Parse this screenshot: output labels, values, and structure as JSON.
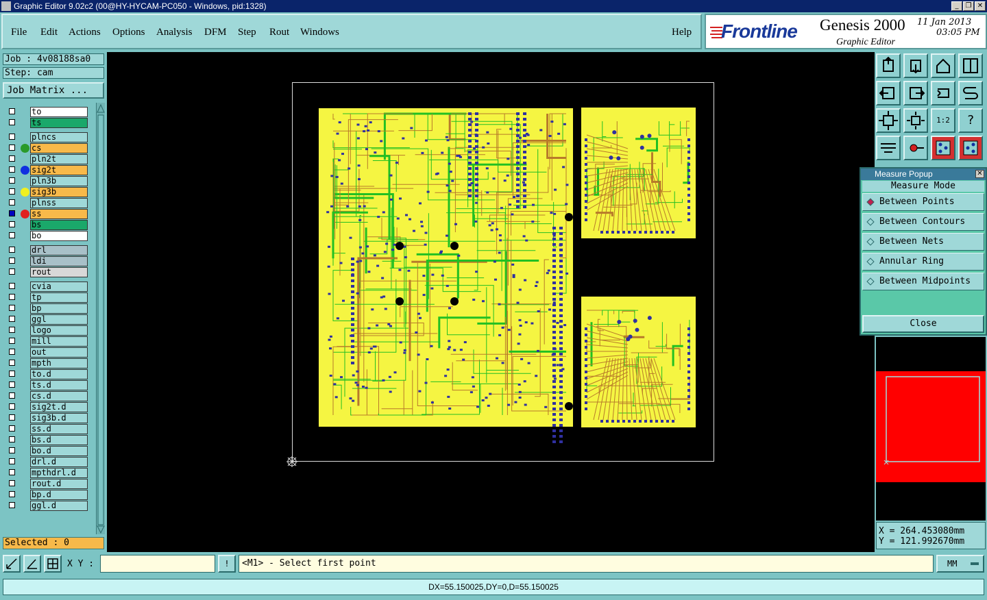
{
  "window": {
    "title": "Graphic Editor 9.02c2 (00@HY-HYCAM-PC050 - Windows, pid:1328)",
    "controls": [
      "_",
      "❐",
      "✕"
    ]
  },
  "menu": {
    "items": [
      "File",
      "Edit",
      "Actions",
      "Options",
      "Analysis",
      "DFM",
      "Step",
      "Rout",
      "Windows"
    ],
    "help": "Help"
  },
  "brand": {
    "logo": "Frontline",
    "product": "Genesis 2000",
    "subtitle": "Graphic Editor",
    "date": "11 Jan 2013",
    "time": "03:05 PM"
  },
  "job": {
    "job_label": "Job : 4v08188sa0",
    "step_label": "Step: cam",
    "matrix_button": "Job Matrix ..."
  },
  "layers": [
    {
      "name": "to",
      "bg": "#ffffff",
      "dot": ""
    },
    {
      "name": "ts",
      "bg": "#1aa86a",
      "dot": ""
    },
    {
      "name": "plncs",
      "bg": "#9fd8d8",
      "dot": ""
    },
    {
      "name": "cs",
      "bg": "#f7b94a",
      "dot": "#2a9a2a"
    },
    {
      "name": "pln2t",
      "bg": "#9fd8d8",
      "dot": ""
    },
    {
      "name": "sig2t",
      "bg": "#f7b94a",
      "dot": "#1030e0"
    },
    {
      "name": "pln3b",
      "bg": "#9fd8d8",
      "dot": ""
    },
    {
      "name": "sig3b",
      "bg": "#f7b94a",
      "dot": "#f0f020"
    },
    {
      "name": "plnss",
      "bg": "#9fd8d8",
      "dot": ""
    },
    {
      "name": "ss",
      "bg": "#f7b94a",
      "dot": "#e02020"
    },
    {
      "name": "bs",
      "bg": "#1aa86a",
      "dot": ""
    },
    {
      "name": "bo",
      "bg": "#ffffff",
      "dot": ""
    },
    {
      "name": "drl",
      "bg": "#a8c0c8",
      "dot": ""
    },
    {
      "name": "ldi",
      "bg": "#a8c0c8",
      "dot": ""
    },
    {
      "name": "rout",
      "bg": "#d8d8d8",
      "dot": ""
    },
    {
      "name": "cvia",
      "bg": "#9fd8d8",
      "dot": ""
    },
    {
      "name": "tp",
      "bg": "#9fd8d8",
      "dot": ""
    },
    {
      "name": "bp",
      "bg": "#9fd8d8",
      "dot": ""
    },
    {
      "name": "ggl",
      "bg": "#9fd8d8",
      "dot": ""
    },
    {
      "name": "logo",
      "bg": "#9fd8d8",
      "dot": ""
    },
    {
      "name": "mill",
      "bg": "#9fd8d8",
      "dot": ""
    },
    {
      "name": "out",
      "bg": "#9fd8d8",
      "dot": ""
    },
    {
      "name": "mpth",
      "bg": "#9fd8d8",
      "dot": ""
    },
    {
      "name": "to.d",
      "bg": "#9fd8d8",
      "dot": ""
    },
    {
      "name": "ts.d",
      "bg": "#9fd8d8",
      "dot": ""
    },
    {
      "name": "cs.d",
      "bg": "#9fd8d8",
      "dot": ""
    },
    {
      "name": "sig2t.d",
      "bg": "#9fd8d8",
      "dot": ""
    },
    {
      "name": "sig3b.d",
      "bg": "#9fd8d8",
      "dot": ""
    },
    {
      "name": "ss.d",
      "bg": "#9fd8d8",
      "dot": ""
    },
    {
      "name": "bs.d",
      "bg": "#9fd8d8",
      "dot": ""
    },
    {
      "name": "bo.d",
      "bg": "#9fd8d8",
      "dot": ""
    },
    {
      "name": "drl.d",
      "bg": "#9fd8d8",
      "dot": ""
    },
    {
      "name": "mpthdrl.d",
      "bg": "#9fd8d8",
      "dot": ""
    },
    {
      "name": "rout.d",
      "bg": "#9fd8d8",
      "dot": ""
    },
    {
      "name": "bp.d",
      "bg": "#9fd8d8",
      "dot": ""
    },
    {
      "name": "ggl.d",
      "bg": "#9fd8d8",
      "dot": ""
    }
  ],
  "selected_label": "Selected : 0",
  "measure": {
    "title": "Measure Popup",
    "mode_label": "Measure Mode",
    "options": [
      "Between Points",
      "Between Contours",
      "Between Nets",
      "Annular Ring",
      "Between Midpoints"
    ],
    "selected_index": 0,
    "close": "Close"
  },
  "toolbar_labels": {
    "ratio": "1:2",
    "help": "?"
  },
  "coords": {
    "x": "X = 264.453080mm",
    "y": "Y = 121.992670mm"
  },
  "bottom": {
    "xy_label": "X Y :",
    "xy_value": "",
    "prompt": "<M1> - Select first point",
    "units": "MM",
    "status": "DX=55.150025,DY=0,D=55.150025"
  },
  "colors": {
    "board": "#f5f542",
    "trace_green": "#22c022",
    "trace_brown": "#b87a2a",
    "pad_blue": "#3030a0",
    "overview_red": "#ff0000"
  }
}
